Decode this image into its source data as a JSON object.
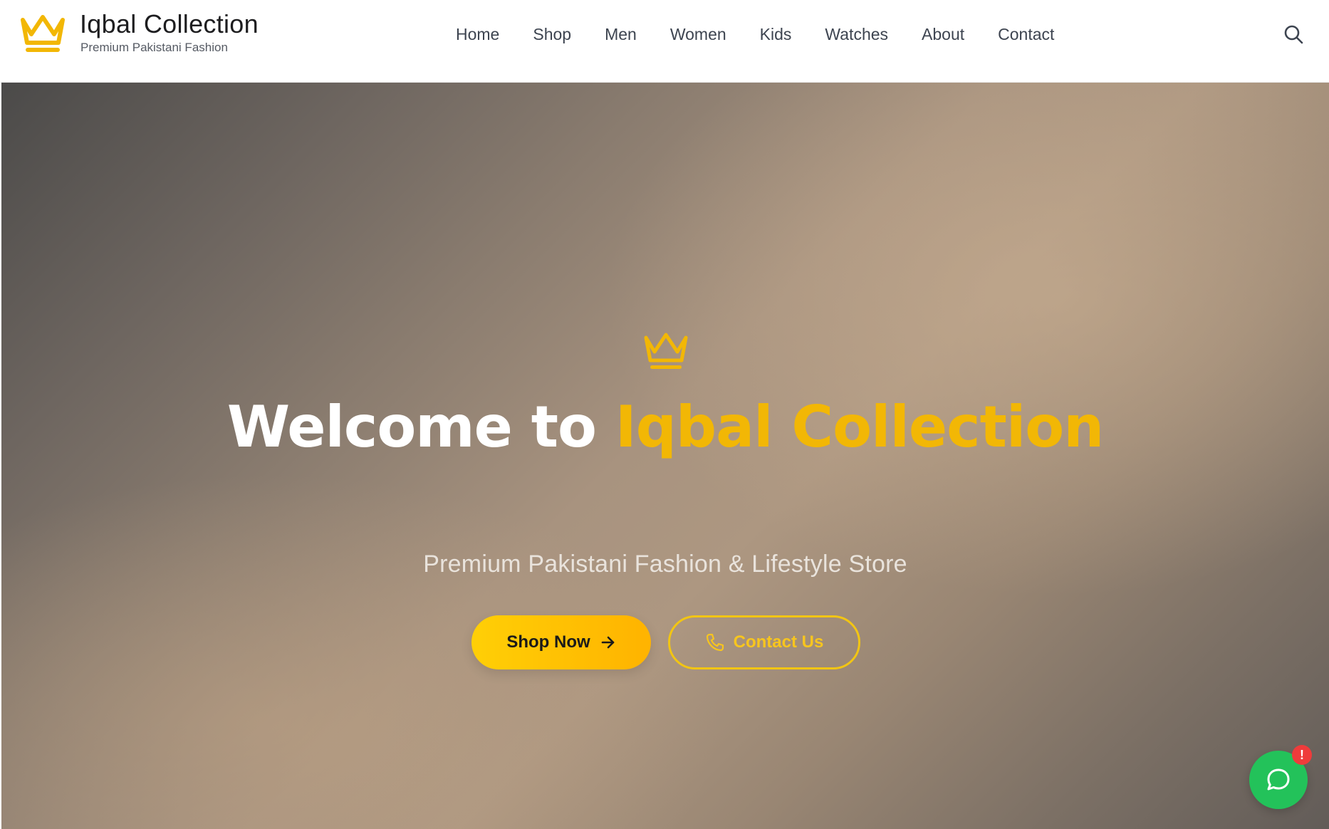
{
  "brand": {
    "name": "Iqbal Collection",
    "tagline": "Premium Pakistani Fashion",
    "accent_color": "#f2b705",
    "logo_icon": "crown-icon"
  },
  "nav": {
    "items": [
      {
        "label": "Home"
      },
      {
        "label": "Shop"
      },
      {
        "label": "Men"
      },
      {
        "label": "Women"
      },
      {
        "label": "Kids"
      },
      {
        "label": "Watches"
      },
      {
        "label": "About"
      },
      {
        "label": "Contact"
      }
    ],
    "search_icon": "search-icon"
  },
  "hero": {
    "icon": "crown-icon",
    "title_part1": "Welcome to ",
    "title_part2": "Iqbal Collection",
    "subtitle": "Premium Pakistani Fashion & Lifestyle Store",
    "primary_button": {
      "label": "Shop Now",
      "icon": "arrow-right-icon"
    },
    "secondary_button": {
      "label": "Contact Us",
      "icon": "phone-icon"
    }
  },
  "chat": {
    "icon": "chat-bubble-icon",
    "badge": "!",
    "button_color": "#23c25a",
    "badge_color": "#ef3b3b"
  }
}
